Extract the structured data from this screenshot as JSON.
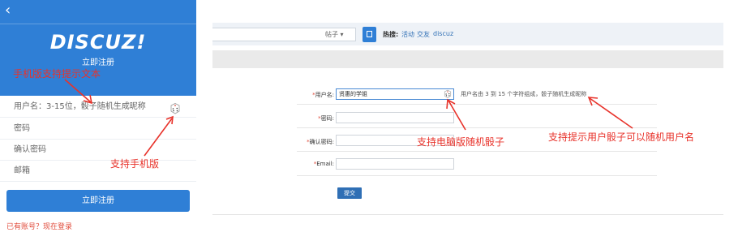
{
  "mobile": {
    "back_icon": "chevron-left-icon",
    "logo": "DISCUZ!",
    "title": "立即注册",
    "fields": {
      "username_placeholder": "用户名：3-15位，骰子随机生成昵称",
      "password": "密码",
      "confirm_password": "确认密码",
      "email": "邮箱"
    },
    "submit": "立即注册",
    "login_link": "已有账号？现在登录",
    "accent": "#2f7fd6"
  },
  "desktop": {
    "search": {
      "select_label": "帖子"
    },
    "hot": {
      "label": "热搜:",
      "links": [
        "活动",
        "交友",
        "discuz"
      ]
    },
    "form": {
      "username_label": "用户名:",
      "username_value": "贤惠的学姐",
      "username_hint": "用户名由 3 到 15 个字符组成，骰子随机生成昵称",
      "password_label": "密码:",
      "confirm_label": "确认密码:",
      "email_label": "Email:",
      "required_mark": "*",
      "submit": "提交"
    }
  },
  "annotations": {
    "mobile_hint": "手机版支持提示文本",
    "mobile_support": "支持手机版",
    "pc_dice": "支持电脑版随机骰子",
    "hint_dice": "支持提示用户骰子可以随机用户名",
    "color": "#e8322a"
  }
}
